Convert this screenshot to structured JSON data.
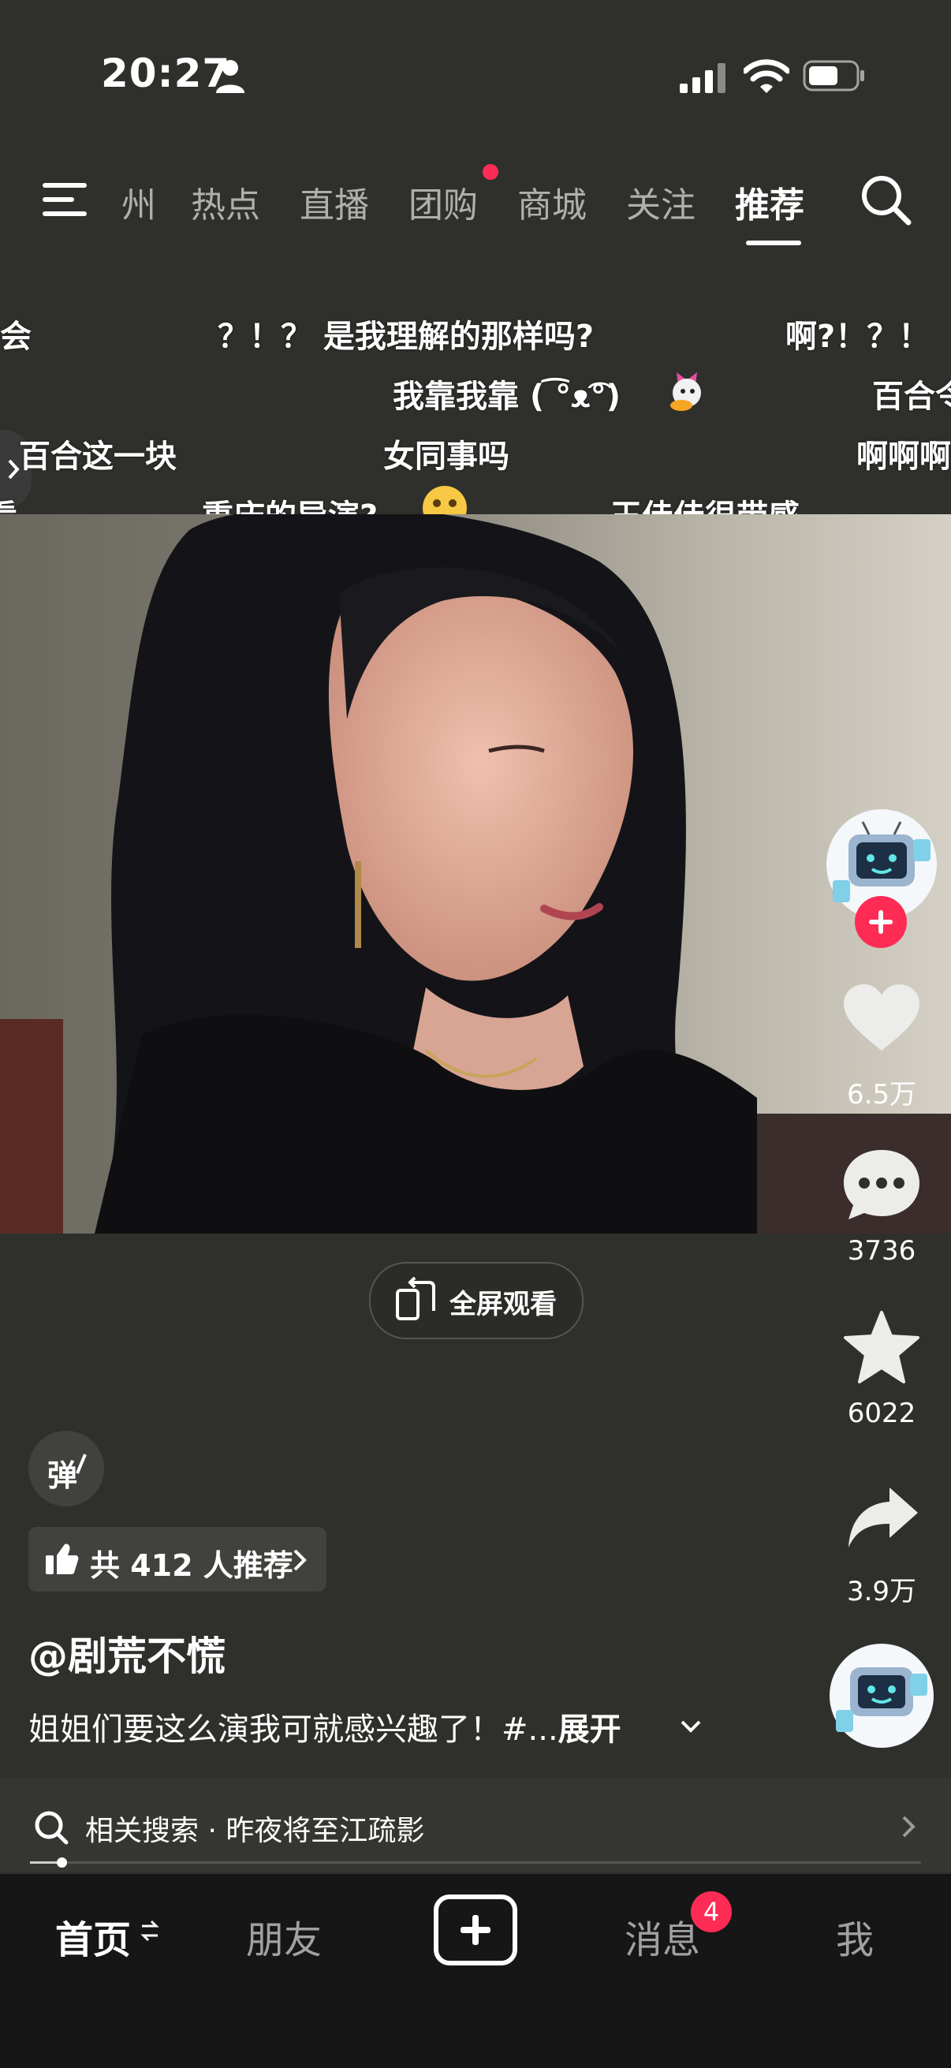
{
  "status_bar": {
    "time": "20:27"
  },
  "top_nav": {
    "tabs": [
      {
        "label": "州"
      },
      {
        "label": "热点"
      },
      {
        "label": "直播"
      },
      {
        "label": "团购"
      },
      {
        "label": "商城"
      },
      {
        "label": "关注"
      },
      {
        "label": "推荐",
        "active": true
      }
    ]
  },
  "danmaku": [
    "会",
    "？！？ 是我理解的那样吗?",
    "啊?！？！",
    "我靠我靠 ( ͡°ᴥ͡°)",
    "百合令",
    "百合这一块",
    "女同事吗",
    "啊啊啊",
    "看",
    "重庆的导演?",
    "王佳佳很带感"
  ],
  "video": {
    "fullscreen_label": "全屏观看"
  },
  "side_actions": {
    "like_count": "6.5万",
    "comment_count": "3736",
    "favorite_count": "6022",
    "share_count": "3.9万"
  },
  "info": {
    "danmaku_toggle": "弹",
    "recommend_text": "共 412 人推荐",
    "author": "@剧荒不慌",
    "caption": "姐姐们要这么演我可就感兴趣了！#...",
    "expand_label": "展开"
  },
  "related_search": {
    "text": "相关搜索 · 昨夜将至江疏影"
  },
  "progress": {
    "fraction": 0.035
  },
  "tab_bar": {
    "home": "首页",
    "friends": "朋友",
    "messages": "消息",
    "messages_badge": "4",
    "me": "我"
  },
  "colors": {
    "accent": "#fe2c55",
    "background": "#2f302c",
    "tabbar": "#161616"
  }
}
